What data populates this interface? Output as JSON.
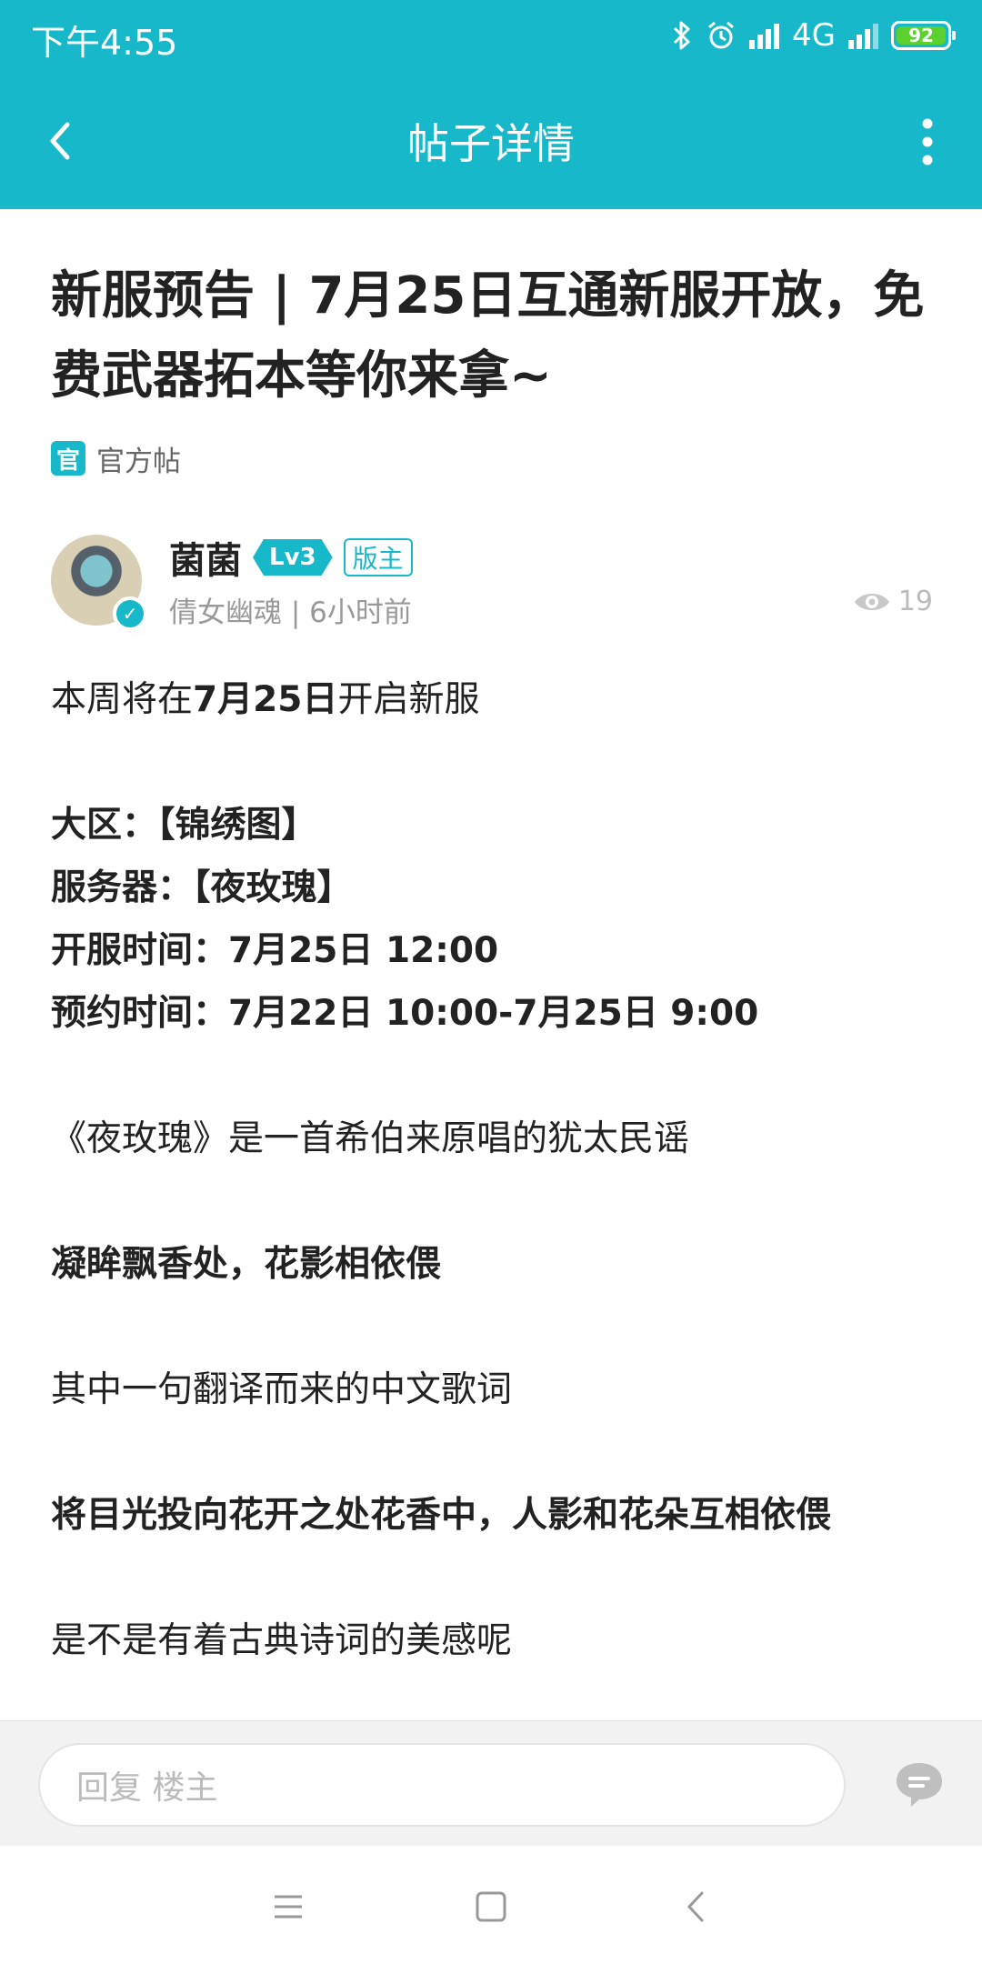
{
  "status_bar": {
    "time": "下午4:55",
    "network": "4G",
    "battery": "92"
  },
  "nav": {
    "title": "帖子详情"
  },
  "post": {
    "title": "新服预告 | 7月25日互通新服开放，免费武器拓本等你来拿~",
    "official_badge": "官",
    "official_label": "官方帖"
  },
  "author": {
    "name": "菌菌",
    "level": "Lv3",
    "role": "版主",
    "meta": "倩女幽魂 | 6小时前",
    "views": "19"
  },
  "content": {
    "line1_pre": "本周将在",
    "line1_bold": "7月25日",
    "line1_post": "开启新服",
    "region": "大区：【锦绣图】",
    "server": "服务器：【夜玫瑰】",
    "open_time": "开服时间：7月25日 12:00",
    "reserve_time": "预约时间：7月22日 10:00-7月25日 9:00",
    "song_intro": "《夜玫瑰》是一首希伯来原唱的犹太民谣",
    "lyric_cn": "凝眸飘香处，花影相依偎",
    "translation_intro": "其中一句翻译而来的中文歌词",
    "translation": "将目光投向花开之处花香中，人影和花朵互相依偎",
    "closing": "是不是有着古典诗词的美感呢"
  },
  "reply": {
    "placeholder": "回复  楼主"
  },
  "colors": {
    "accent": "#17b8c9",
    "battery": "#5ad12e"
  },
  "icons": [
    "back-arrow-icon",
    "more-vertical-icon",
    "verified-icon",
    "eye-icon",
    "comment-bubble-icon",
    "menu-icon",
    "home-square-icon",
    "back-chevron-icon",
    "bluetooth-icon",
    "alarm-icon",
    "signal-icon"
  ]
}
